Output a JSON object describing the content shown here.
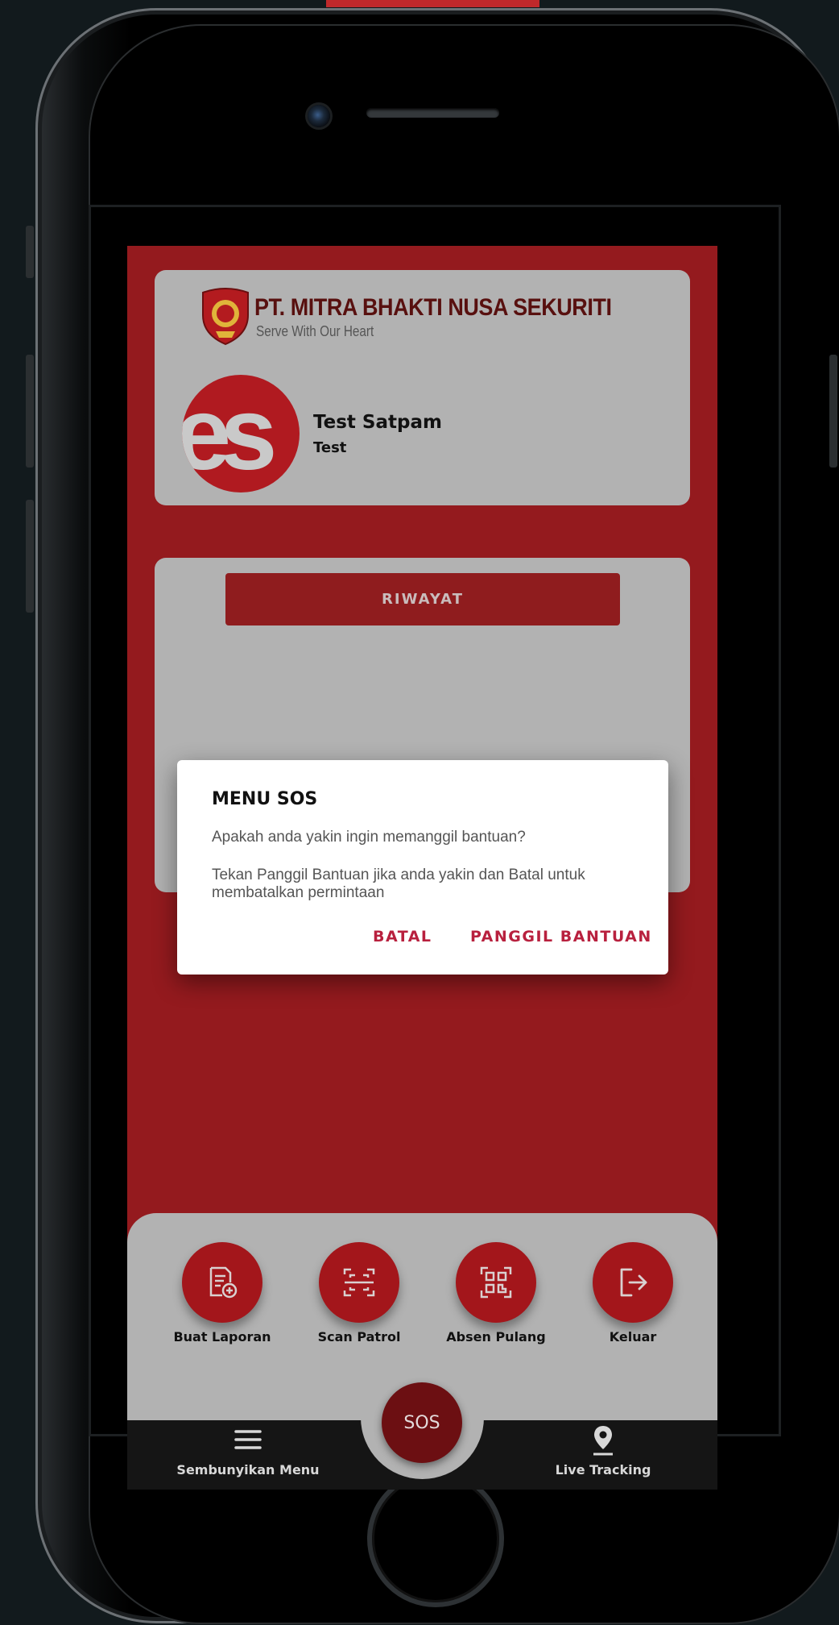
{
  "header": {
    "company_name": "PT. MITRA BHAKTI NUSA SEKURITI",
    "tagline": "Serve With Our Heart",
    "avatar_text": "es",
    "user_name": "Test Satpam",
    "user_role": "Test"
  },
  "history": {
    "button_label": "RIWAYAT"
  },
  "dialog": {
    "title": "MENU SOS",
    "message1": "Apakah anda yakin ingin memanggil bantuan?",
    "message2": "Tekan Panggil Bantuan jika anda yakin dan Batal untuk membatalkan permintaan",
    "cancel_label": "BATAL",
    "confirm_label": "PANGGIL BANTUAN"
  },
  "actions": [
    {
      "label": "Buat Laporan",
      "icon": "add-report-icon"
    },
    {
      "label": "Scan Patrol",
      "icon": "scan-icon"
    },
    {
      "label": "Absen Pulang",
      "icon": "qr-code-icon"
    },
    {
      "label": "Keluar",
      "icon": "logout-icon"
    }
  ],
  "nav": {
    "menu_label": "Sembunyikan Menu",
    "sos_label": "SOS",
    "tracking_label": "Live Tracking"
  },
  "colors": {
    "brand_red": "#941a1e",
    "accent_text": "#b8203e",
    "card_gray": "#b2b2b2"
  }
}
